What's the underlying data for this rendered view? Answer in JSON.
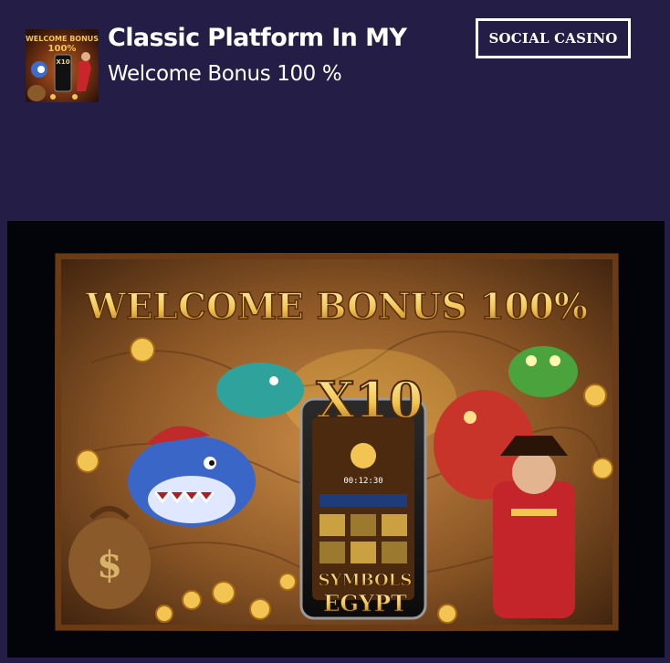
{
  "header": {
    "title": "Classic Platform In MY",
    "subtitle": "Welcome Bonus 100 %",
    "badge_label": "SOCIAL CASINO"
  },
  "icon": {
    "line1": "WELCOME BONUS",
    "line2": "100%",
    "multiplier": "X10"
  },
  "banner": {
    "headline": "WELCOME BONUS 100%",
    "multiplier": "X10",
    "game_line1": "SYMBOLS",
    "game_line2": "EGYPT",
    "phone_timer": "00:12:30"
  },
  "colors": {
    "page_background": "#241e47",
    "banner_background": "#03030a",
    "gold": "#f2c552",
    "text": "#ffffff"
  }
}
